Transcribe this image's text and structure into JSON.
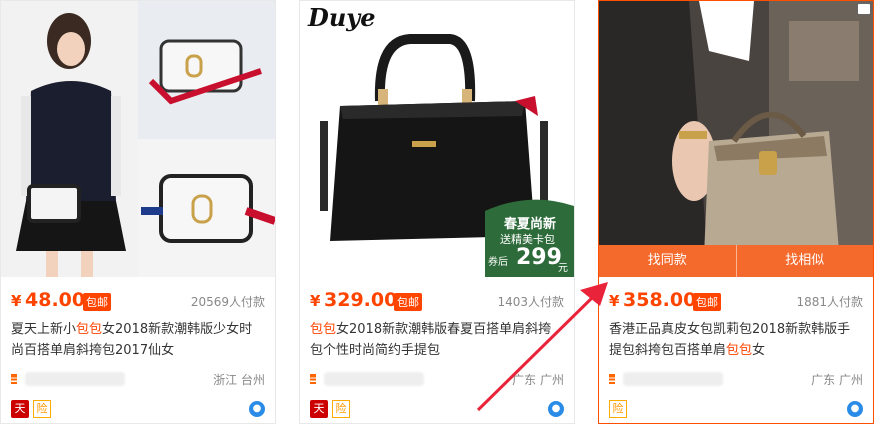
{
  "cards": [
    {
      "currency": "¥",
      "price": "48.00",
      "badge": "包邮",
      "sales": "20569人付款",
      "title_pre": "夏天上新小",
      "title_hl": "包包",
      "title_post": "女2018新款潮韩版少女时尚百搭单肩斜挎包2017仙女",
      "location": "浙江 台州",
      "tmall_icon": "天",
      "guard_icon": "险"
    },
    {
      "currency": "¥",
      "price": "329.00",
      "badge": "包邮",
      "sales": "1403人付款",
      "title_pre": "",
      "title_hl": "包包",
      "title_post": "女2018新款潮韩版春夏百搭单肩斜挎包个性时尚简约手提包",
      "location": "广东 广州",
      "tmall_icon": "天",
      "guard_icon": "险",
      "brand": "Duye",
      "promo": {
        "line1": "春夏尚新",
        "line2": "送精美卡包",
        "line3": "券后",
        "price": "299",
        "unit": "元"
      }
    },
    {
      "currency": "¥",
      "price": "358.00",
      "badge": "包邮",
      "sales": "1881人付款",
      "title_pre": "香港正品真皮女包凯莉包2018新款韩版手提包斜挎包百搭单肩",
      "title_hl": "包包",
      "title_post": "女",
      "location": "广东 广州",
      "guard_icon": "险",
      "find_same": "找同款",
      "find_similar": "找相似"
    }
  ],
  "colors": {
    "accent": "#ff4400",
    "action_bar": "#f46a2d",
    "arrow": "#e8233a"
  }
}
